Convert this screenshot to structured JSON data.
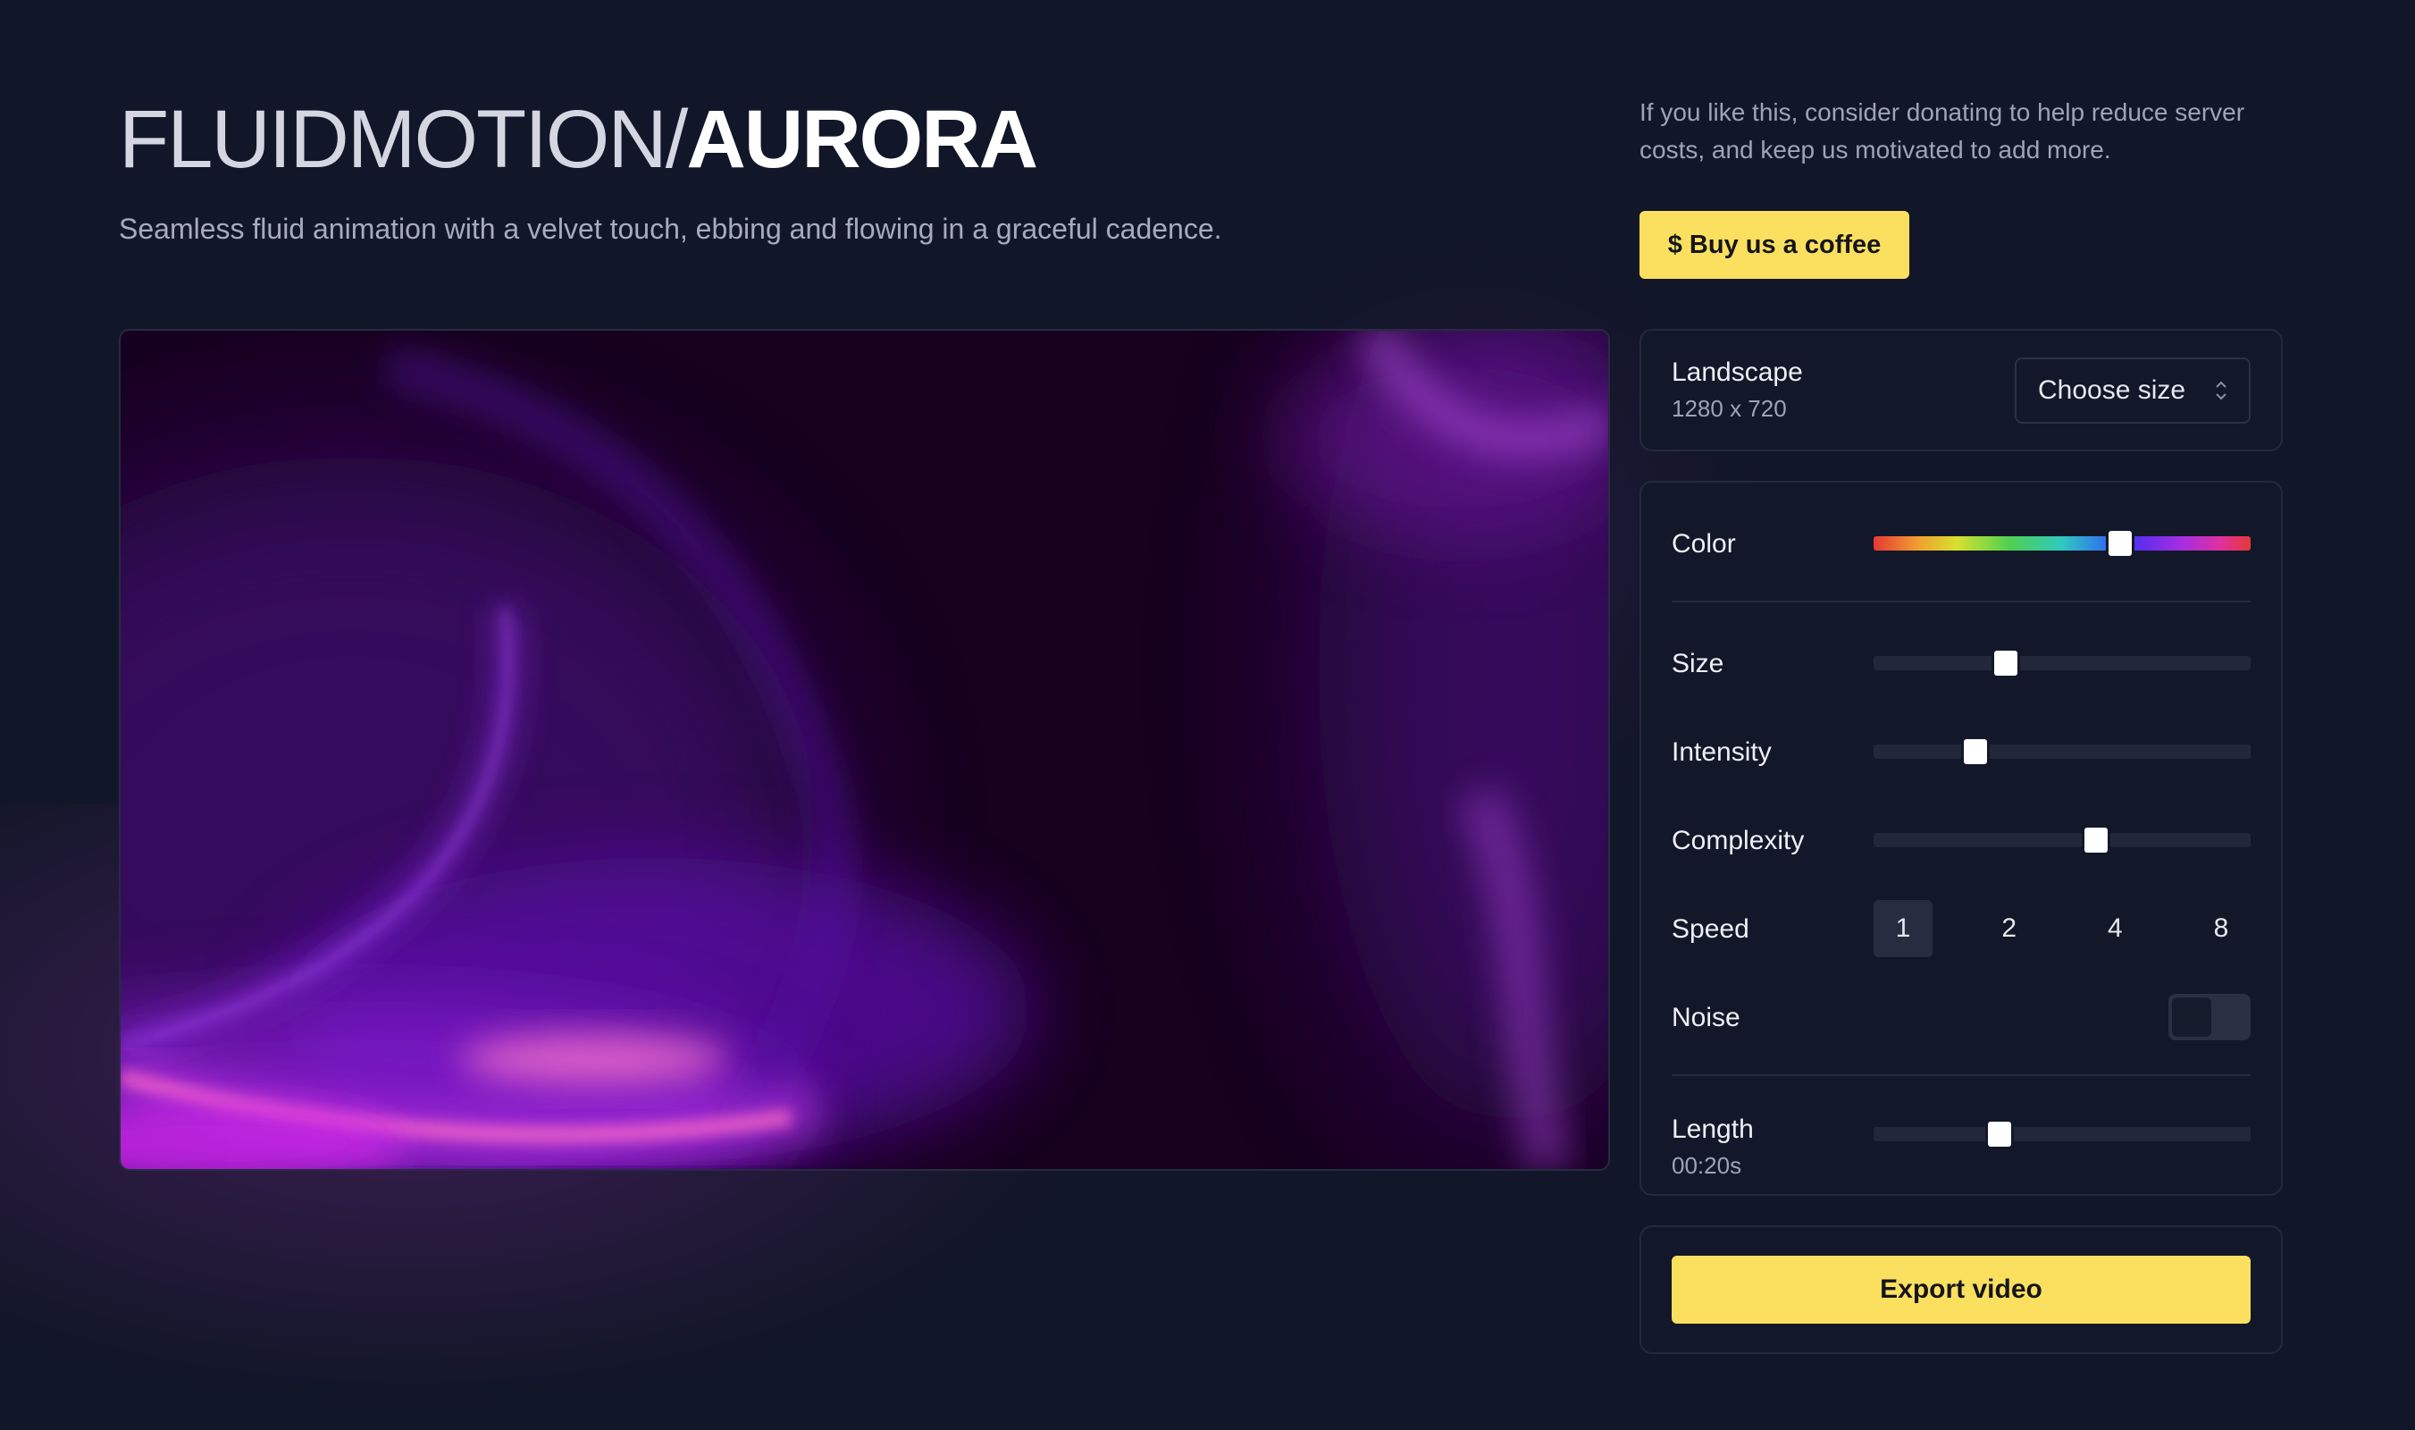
{
  "header": {
    "title_prefix": "FLUIDMOTION/",
    "title_name": "AURORA",
    "subtitle": "Seamless fluid animation with a velvet touch, ebbing and flowing in a graceful cadence."
  },
  "donate": {
    "text": "If you like this, consider donating to help reduce server costs, and keep us motivated to add more.",
    "button_label": "$ Buy us a coffee"
  },
  "size_panel": {
    "orientation": "Landscape",
    "dimensions": "1280 x 720",
    "select_label": "Choose size"
  },
  "controls": {
    "color": {
      "label": "Color",
      "value_fraction": 0.655
    },
    "size": {
      "label": "Size",
      "value_fraction": 0.35
    },
    "intensity": {
      "label": "Intensity",
      "value_fraction": 0.27
    },
    "complexity": {
      "label": "Complexity",
      "value_fraction": 0.59
    },
    "speed": {
      "label": "Speed",
      "options": [
        "1",
        "2",
        "4",
        "8"
      ],
      "selected": "1"
    },
    "noise": {
      "label": "Noise",
      "enabled": false
    },
    "length": {
      "label": "Length",
      "value": "00:20s",
      "value_fraction": 0.335
    }
  },
  "export": {
    "button_label": "Export video"
  },
  "colors": {
    "accent": "#fbe060",
    "background": "#111628",
    "panel_border": "#232a3d"
  }
}
